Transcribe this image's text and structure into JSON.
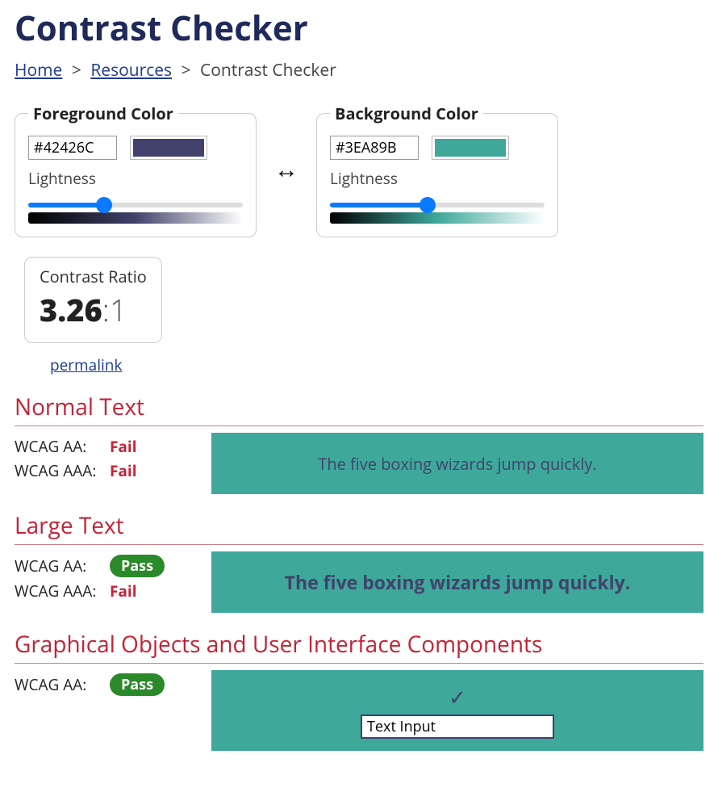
{
  "title": "Contrast Checker",
  "breadcrumb": {
    "home": "Home",
    "resources": "Resources",
    "current": "Contrast Checker"
  },
  "foreground": {
    "legend": "Foreground Color",
    "hex": "#42426C",
    "lightness_label": "Lightness",
    "lightness_value": 34
  },
  "background": {
    "legend": "Background Color",
    "hex": "#3EA89B",
    "lightness_label": "Lightness",
    "lightness_value": 45
  },
  "swap_label": "↔",
  "ratio": {
    "title": "Contrast Ratio",
    "value": "3.26",
    "suffix": ":1"
  },
  "permalink_label": "permalink",
  "normal_text": {
    "heading": "Normal Text",
    "aa_label": "WCAG AA:",
    "aa_result": "Fail",
    "aa_pass": false,
    "aaa_label": "WCAG AAA:",
    "aaa_result": "Fail",
    "aaa_pass": false,
    "sample": "The five boxing wizards jump quickly."
  },
  "large_text": {
    "heading": "Large Text",
    "aa_label": "WCAG AA:",
    "aa_result": "Pass",
    "aa_pass": true,
    "aaa_label": "WCAG AAA:",
    "aaa_result": "Fail",
    "aaa_pass": false,
    "sample": "The five boxing wizards jump quickly."
  },
  "ui_components": {
    "heading": "Graphical Objects and User Interface Components",
    "aa_label": "WCAG AA:",
    "aa_result": "Pass",
    "aa_pass": true,
    "input_value": "Text Input"
  },
  "colors": {
    "foreground": "#42426C",
    "background": "#3EA89B"
  }
}
